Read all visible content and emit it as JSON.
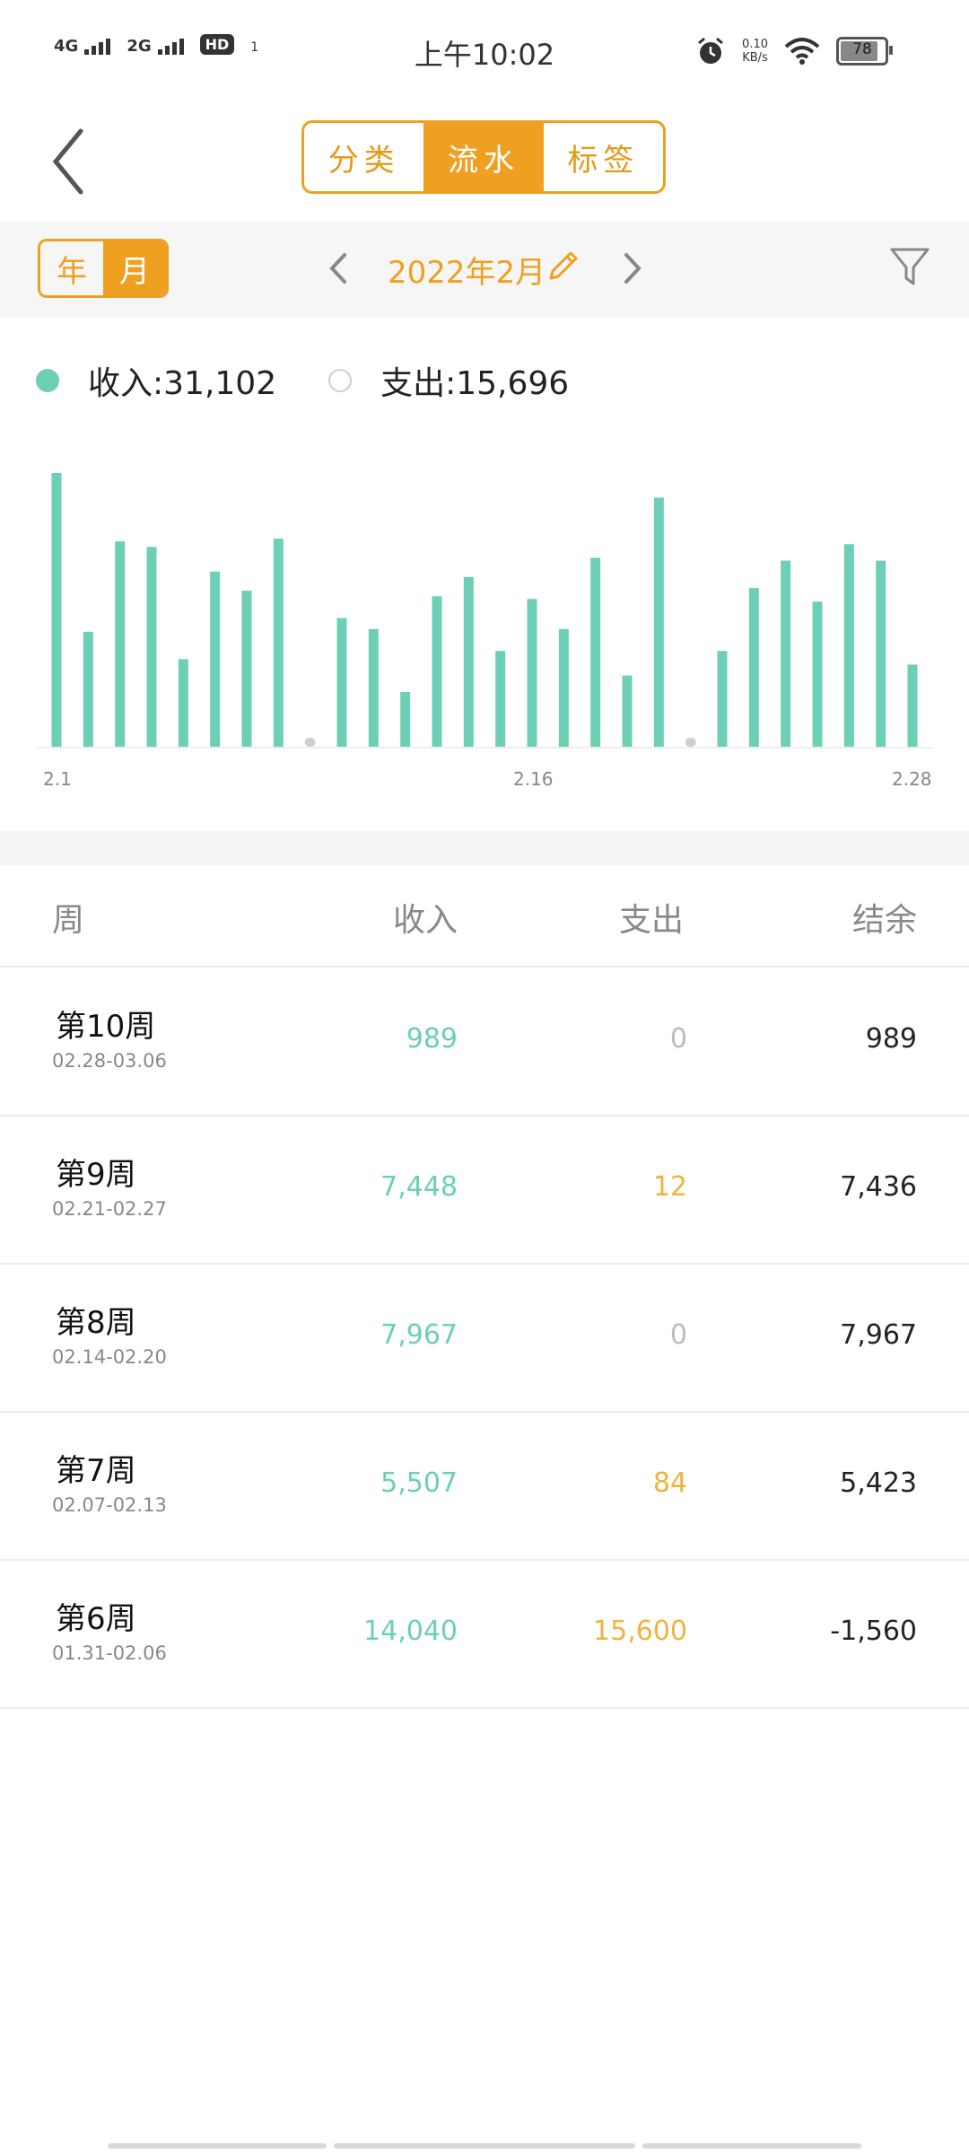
{
  "status": {
    "sig1": "4G",
    "sig2": "2G",
    "hd": "HD",
    "hd_sub": "1",
    "time": "上午10:02",
    "speed_value": "0.10",
    "speed_unit": "KB/s",
    "battery": "78"
  },
  "header": {
    "tabs": [
      "分类",
      "流水",
      "标签"
    ],
    "active_tab": 1
  },
  "datebar": {
    "year_label": "年",
    "month_label": "月",
    "current": "2022年2月"
  },
  "summary": {
    "income_label": "收入:31,102",
    "expense_label": "支出:15,696"
  },
  "chart_data": {
    "type": "bar",
    "categories": [
      "2.1",
      "2.2",
      "2.3",
      "2.4",
      "2.5",
      "2.6",
      "2.7",
      "2.8",
      "2.9",
      "2.10",
      "2.11",
      "2.12",
      "2.13",
      "2.14",
      "2.15",
      "2.16",
      "2.17",
      "2.18",
      "2.19",
      "2.20",
      "2.21",
      "2.22",
      "2.23",
      "2.24",
      "2.25",
      "2.26",
      "2.27",
      "2.28"
    ],
    "values": [
      100,
      42,
      75,
      73,
      32,
      64,
      57,
      76,
      0,
      47,
      43,
      20,
      55,
      62,
      35,
      54,
      43,
      69,
      26,
      91,
      0,
      35,
      58,
      68,
      53,
      74,
      68,
      30
    ],
    "tick_labels": [
      "2.1",
      "2.16",
      "2.28"
    ],
    "ylim": [
      0,
      100
    ],
    "color": "#6dcfb6",
    "zero_color": "#d0d0d0"
  },
  "table": {
    "headers": [
      "周",
      "收入",
      "支出",
      "结余"
    ],
    "rows": [
      {
        "week": "第10周",
        "range": "02.28-03.06",
        "income": "989",
        "expense": "0",
        "balance": "989"
      },
      {
        "week": "第9周",
        "range": "02.21-02.27",
        "income": "7,448",
        "expense": "12",
        "balance": "7,436"
      },
      {
        "week": "第8周",
        "range": "02.14-02.20",
        "income": "7,967",
        "expense": "0",
        "balance": "7,967"
      },
      {
        "week": "第7周",
        "range": "02.07-02.13",
        "income": "5,507",
        "expense": "84",
        "balance": "5,423"
      },
      {
        "week": "第6周",
        "range": "01.31-02.06",
        "income": "14,040",
        "expense": "15,600",
        "balance": "-1,560"
      }
    ]
  }
}
